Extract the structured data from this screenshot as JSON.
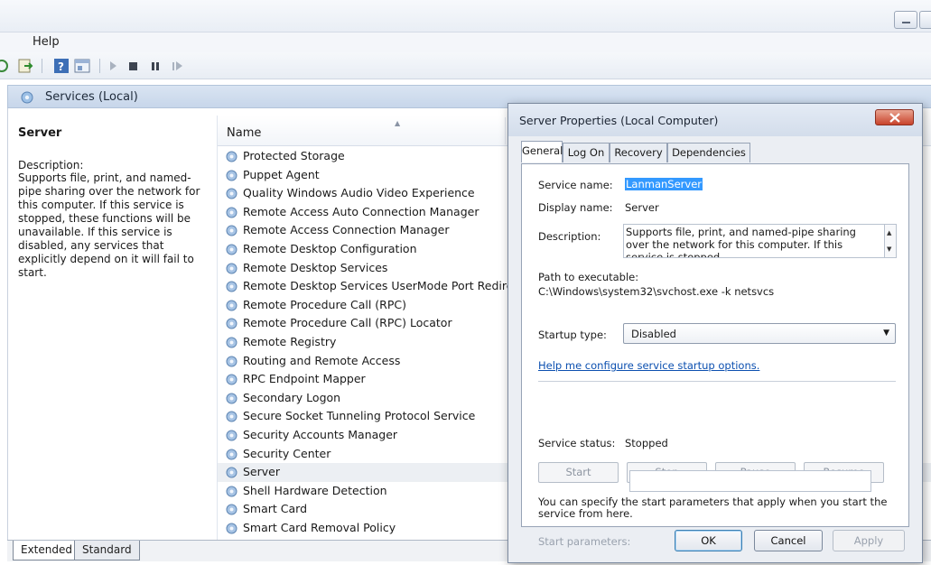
{
  "menubar": {
    "help": "Help"
  },
  "console": {
    "title": "Services (Local)"
  },
  "left_pane": {
    "service_name": "Server",
    "description_label": "Description:",
    "description": "Supports file, print, and named-pipe sharing over the network for this computer. If this service is stopped, these functions will be unavailable. If this service is disabled, any services that explicitly depend on it will fail to start."
  },
  "list": {
    "column_name": "Name",
    "items": [
      "Protected Storage",
      "Puppet Agent",
      "Quality Windows Audio Video Experience",
      "Remote Access Auto Connection Manager",
      "Remote Access Connection Manager",
      "Remote Desktop Configuration",
      "Remote Desktop Services",
      "Remote Desktop Services UserMode Port Redirector",
      "Remote Procedure Call (RPC)",
      "Remote Procedure Call (RPC) Locator",
      "Remote Registry",
      "Routing and Remote Access",
      "RPC Endpoint Mapper",
      "Secondary Logon",
      "Secure Socket Tunneling Protocol Service",
      "Security Accounts Manager",
      "Security Center",
      "Server",
      "Shell Hardware Detection",
      "Smart Card",
      "Smart Card Removal Policy"
    ],
    "selected": "Server"
  },
  "bottom_tabs": {
    "extended": "Extended",
    "standard": "Standard"
  },
  "dialog": {
    "title": "Server Properties (Local Computer)",
    "tabs": [
      "General",
      "Log On",
      "Recovery",
      "Dependencies"
    ],
    "service_name_label": "Service name:",
    "service_name": "LanmanServer",
    "display_name_label": "Display name:",
    "display_name": "Server",
    "description_label": "Description:",
    "description": "Supports file, print, and named-pipe sharing over the network for this computer. If this service is stopped,",
    "path_label": "Path to executable:",
    "path": "C:\\Windows\\system32\\svchost.exe -k netsvcs",
    "startup_type_label": "Startup type:",
    "startup_type": "Disabled",
    "help_link": "Help me configure service startup options.",
    "status_label": "Service status:",
    "status": "Stopped",
    "buttons": {
      "start": "Start",
      "stop": "Stop",
      "pause": "Pause",
      "resume": "Resume"
    },
    "params_note": "You can specify the start parameters that apply when you start the service from here.",
    "start_params_label": "Start parameters:",
    "start_params_value": "",
    "ok": "OK",
    "cancel": "Cancel",
    "apply": "Apply"
  },
  "colors": {
    "selection": "#3399ff",
    "link": "#0c50b0",
    "close_button": "#c8432b"
  }
}
